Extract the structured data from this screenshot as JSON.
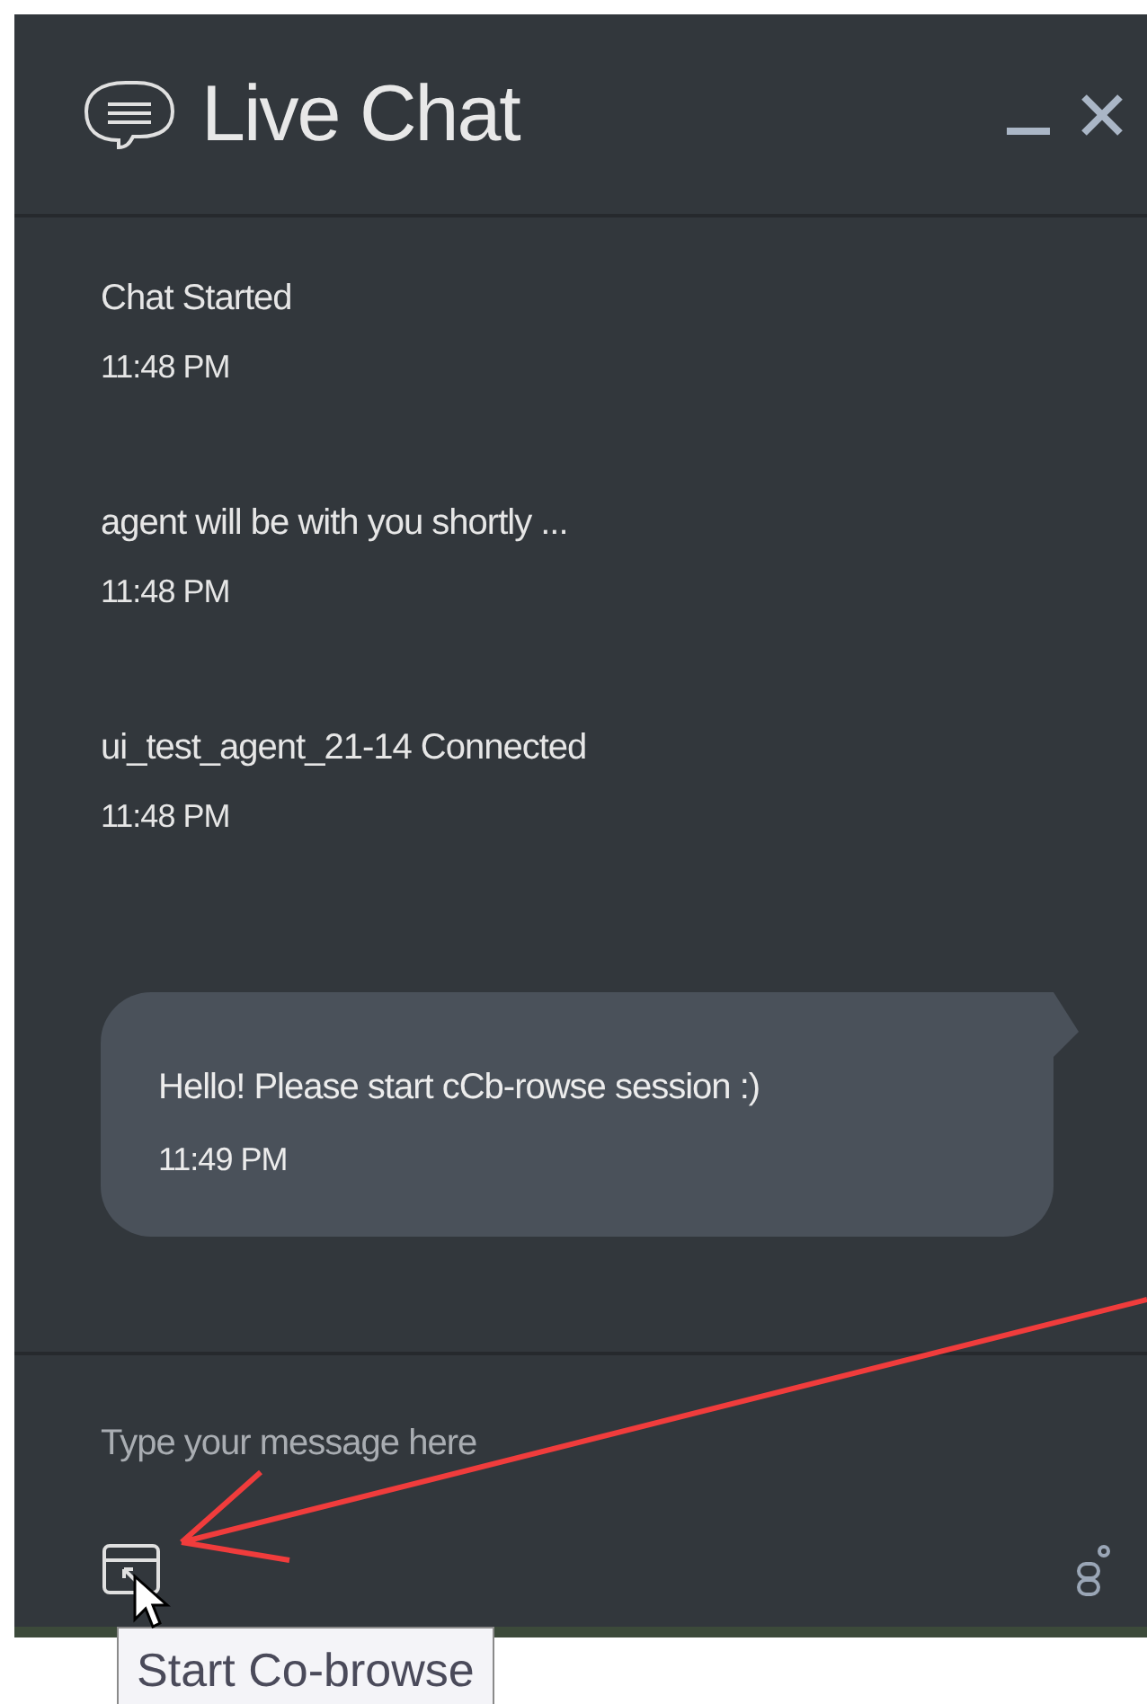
{
  "header": {
    "title": "Live Chat"
  },
  "messages": [
    {
      "kind": "system",
      "text": "Chat Started",
      "time": "11:48 PM"
    },
    {
      "kind": "system",
      "text": "agent will be with you shortly ...",
      "time": "11:48 PM"
    },
    {
      "kind": "system",
      "text": "ui_test_agent_21-14 Connected",
      "time": "11:48 PM"
    },
    {
      "kind": "bubble",
      "text": "Hello! Please start cCb-rowse session :)",
      "time": "11:49 PM"
    }
  ],
  "composer": {
    "placeholder": "Type your message here"
  },
  "tooltip": "Start Co-browse"
}
